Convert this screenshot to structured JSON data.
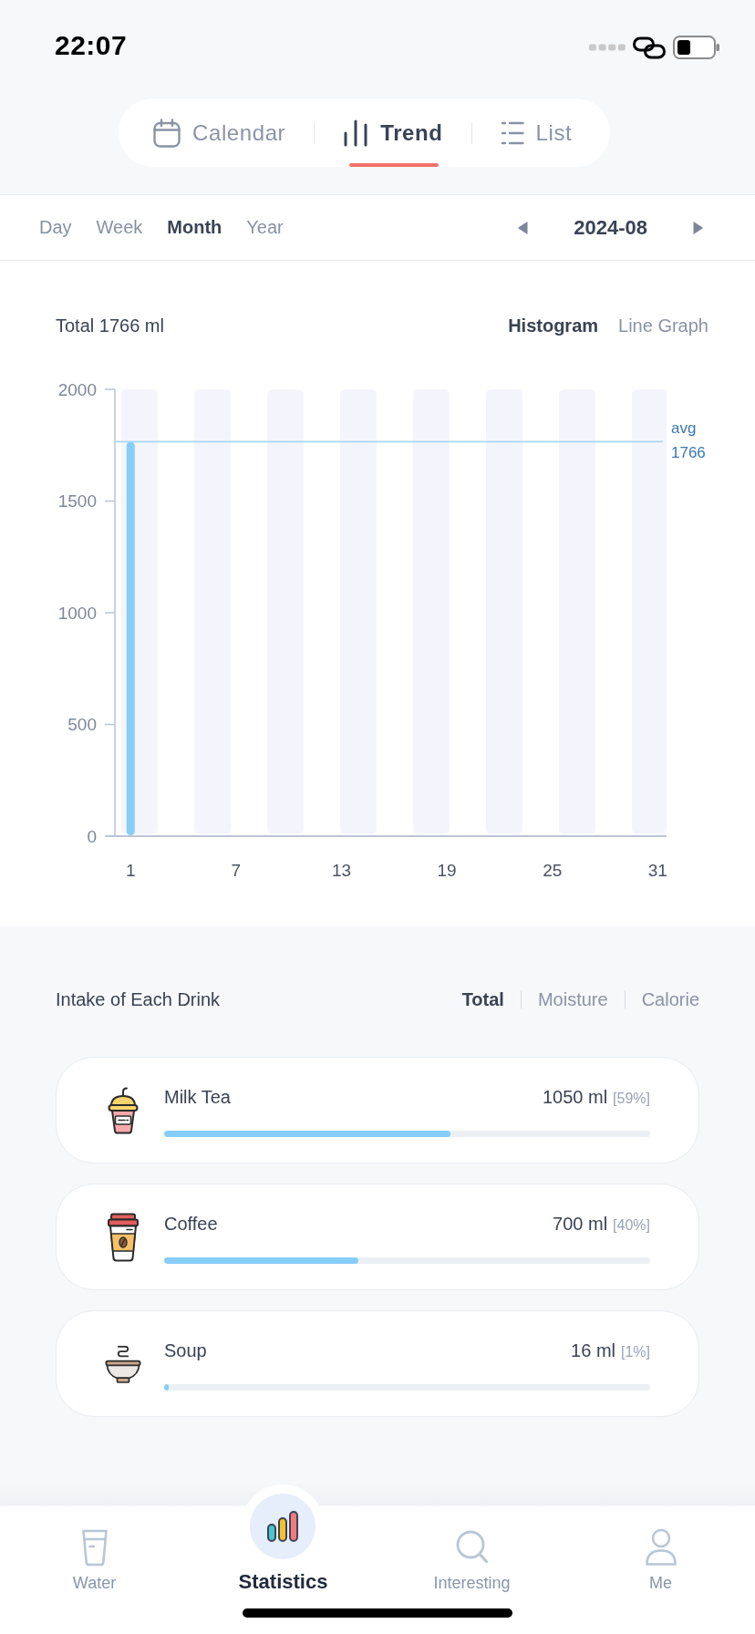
{
  "status_bar": {
    "time": "22:07"
  },
  "view_tabs": [
    {
      "kind": "calendar",
      "label": "Calendar",
      "selected": false
    },
    {
      "kind": "trend",
      "label": "Trend",
      "selected": true
    },
    {
      "kind": "list",
      "label": "List",
      "selected": false
    }
  ],
  "period_tabs": [
    {
      "label": "Day",
      "selected": false
    },
    {
      "label": "Week",
      "selected": false
    },
    {
      "label": "Month",
      "selected": true
    },
    {
      "label": "Year",
      "selected": false
    }
  ],
  "date_picker": {
    "value": "2024-08"
  },
  "chart_panel": {
    "total": "Total 1766 ml",
    "chart_types": [
      {
        "label": "Histogram",
        "selected": true
      },
      {
        "label": "Line Graph",
        "selected": false
      }
    ],
    "chart_data": {
      "type": "bar",
      "x": [
        1
      ],
      "values": [
        1766
      ],
      "xlim": [
        0,
        31.5
      ],
      "xticks": [
        1,
        7,
        13,
        19,
        25,
        31
      ],
      "ylim": [
        0,
        2000
      ],
      "yticks": [
        0,
        500,
        1000,
        1500,
        2000
      ],
      "ref_lines": [
        {
          "axis": "y",
          "value": 1766,
          "label": "avg 1766"
        }
      ]
    }
  },
  "drinks_panel": {
    "title": "Intake of Each Drink",
    "metrics": [
      {
        "label": "Total",
        "selected": true
      },
      {
        "label": "Moisture",
        "selected": false
      },
      {
        "label": "Calorie",
        "selected": false
      }
    ],
    "drinks": [
      {
        "kind": "milk_tea",
        "name": "Milk Tea",
        "amount": "1050 ml",
        "share": "[59%]",
        "level": 0.59
      },
      {
        "kind": "coffee",
        "name": "Coffee",
        "amount": "700 ml",
        "share": "[40%]",
        "level": 0.4
      },
      {
        "kind": "soup",
        "name": "Soup",
        "amount": "16 ml",
        "share": "[1%]",
        "level": 0.01
      }
    ]
  },
  "tab_bar": [
    {
      "kind": "water",
      "label": "Water",
      "selected": false
    },
    {
      "kind": "statistics",
      "label": "Statistics",
      "selected": true
    },
    {
      "kind": "search",
      "label": "Interesting",
      "selected": false
    },
    {
      "kind": "profile",
      "label": "Me",
      "selected": false
    }
  ]
}
